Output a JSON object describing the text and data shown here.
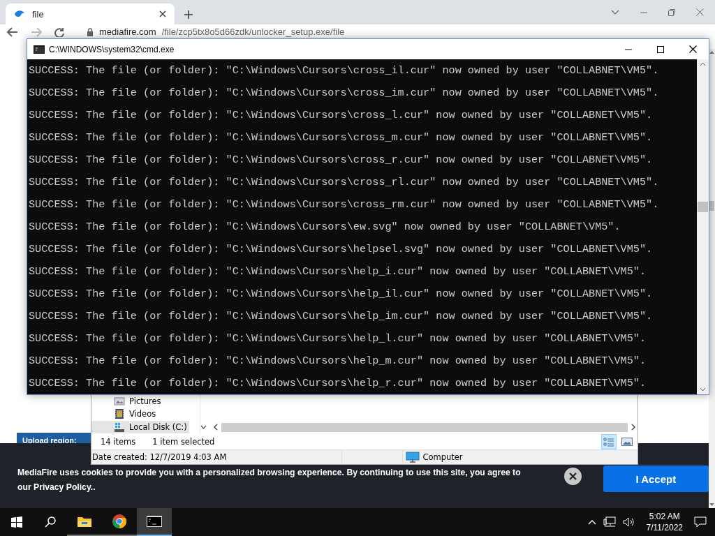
{
  "browser": {
    "tab": {
      "title": "file"
    },
    "address": {
      "domain": "mediafire.com",
      "path": "/file/zcp5tx8o5d66zdk/unlocker_setup.exe/file"
    }
  },
  "page": {
    "upload_region_label": "Upload region:"
  },
  "explorer": {
    "nav_items": [
      {
        "label": "Pictures",
        "kind": "pictures",
        "selected": false
      },
      {
        "label": "Videos",
        "kind": "videos",
        "selected": false
      },
      {
        "label": "Local Disk (C:)",
        "kind": "disk",
        "selected": true
      }
    ],
    "item_count": "14 items",
    "selection": "1 item selected",
    "details": "Date created: 12/7/2019 4:03 AM",
    "location": "Computer"
  },
  "cookie_banner": {
    "text": "MediaFire uses cookies to provide you with a personalized browsing experience. By continuing to use this site, you agree to our Privacy Policy..",
    "accept_button": "I Accept"
  },
  "console": {
    "title": "C:\\WINDOWS\\system32\\cmd.exe",
    "lines": [
      "SUCCESS: The file (or folder): \"C:\\Windows\\Cursors\\cross_il.cur\" now owned by user \"COLLABNET\\VM5\".",
      "SUCCESS: The file (or folder): \"C:\\Windows\\Cursors\\cross_im.cur\" now owned by user \"COLLABNET\\VM5\".",
      "SUCCESS: The file (or folder): \"C:\\Windows\\Cursors\\cross_l.cur\" now owned by user \"COLLABNET\\VM5\".",
      "SUCCESS: The file (or folder): \"C:\\Windows\\Cursors\\cross_m.cur\" now owned by user \"COLLABNET\\VM5\".",
      "SUCCESS: The file (or folder): \"C:\\Windows\\Cursors\\cross_r.cur\" now owned by user \"COLLABNET\\VM5\".",
      "SUCCESS: The file (or folder): \"C:\\Windows\\Cursors\\cross_rl.cur\" now owned by user \"COLLABNET\\VM5\".",
      "SUCCESS: The file (or folder): \"C:\\Windows\\Cursors\\cross_rm.cur\" now owned by user \"COLLABNET\\VM5\".",
      "SUCCESS: The file (or folder): \"C:\\Windows\\Cursors\\ew.svg\" now owned by user \"COLLABNET\\VM5\".",
      "SUCCESS: The file (or folder): \"C:\\Windows\\Cursors\\helpsel.svg\" now owned by user \"COLLABNET\\VM5\".",
      "SUCCESS: The file (or folder): \"C:\\Windows\\Cursors\\help_i.cur\" now owned by user \"COLLABNET\\VM5\".",
      "SUCCESS: The file (or folder): \"C:\\Windows\\Cursors\\help_il.cur\" now owned by user \"COLLABNET\\VM5\".",
      "SUCCESS: The file (or folder): \"C:\\Windows\\Cursors\\help_im.cur\" now owned by user \"COLLABNET\\VM5\".",
      "SUCCESS: The file (or folder): \"C:\\Windows\\Cursors\\help_l.cur\" now owned by user \"COLLABNET\\VM5\".",
      "SUCCESS: The file (or folder): \"C:\\Windows\\Cursors\\help_m.cur\" now owned by user \"COLLABNET\\VM5\".",
      "SUCCESS: The file (or folder): \"C:\\Windows\\Cursors\\help_r.cur\" now owned by user \"COLLABNET\\VM5\"."
    ]
  },
  "taskbar": {
    "apps": [
      {
        "kind": "explorer",
        "selected": false
      },
      {
        "kind": "chrome",
        "selected": false
      },
      {
        "kind": "cmd",
        "selected": true
      }
    ],
    "time": "5:02 AM",
    "date": "7/11/2022"
  }
}
